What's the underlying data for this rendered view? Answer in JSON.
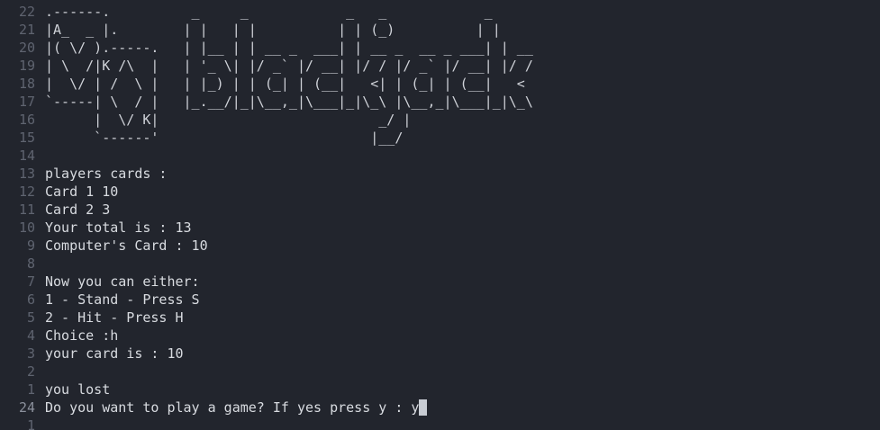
{
  "terminal": {
    "ascii_rows": [
      {
        "number": "22",
        "text": ".------.          _     _            _   _            _"
      },
      {
        "number": "21",
        "text": "|A_  _ |.        | |   | |          | | (_)          | |"
      },
      {
        "number": "20",
        "text": "|( \\/ ).-----.   | |__ | | __ _  ___| | __ _  __ _ ___| | __"
      },
      {
        "number": "19",
        "text": "| \\  /|K /\\  |   | '_ \\| |/ _` |/ __| |/ / |/ _` |/ __| |/ /"
      },
      {
        "number": "18",
        "text": "|  \\/ | /  \\ |   | |_) | | (_| | (__|   <| | (_| | (__|   <"
      },
      {
        "number": "17",
        "text": "`-----| \\  / |   |_.__/|_|\\__,_|\\___|_|\\_\\ |\\__,_|\\___|_|\\_\\"
      },
      {
        "number": "16",
        "text": "      |  \\/ K|                           _/ |"
      },
      {
        "number": "15",
        "text": "      `------'                          |__/"
      }
    ],
    "output_rows": [
      {
        "number": "14",
        "text": ""
      },
      {
        "number": "13",
        "text": "players cards :"
      },
      {
        "number": "12",
        "text": "Card 1 10"
      },
      {
        "number": "11",
        "text": "Card 2 3"
      },
      {
        "number": "10",
        "text": "Your total is : 13"
      },
      {
        "number": "9",
        "text": "Computer's Card : 10"
      },
      {
        "number": "8",
        "text": ""
      },
      {
        "number": "7",
        "text": "Now you can either:"
      },
      {
        "number": "6",
        "text": "1 - Stand - Press S"
      },
      {
        "number": "5",
        "text": "2 - Hit - Press H"
      },
      {
        "number": "4",
        "text": "Choice :h"
      },
      {
        "number": "3",
        "text": "your card is : 10"
      },
      {
        "number": "2",
        "text": ""
      },
      {
        "number": "1",
        "text": "you lost"
      }
    ],
    "current_row": {
      "number": "24",
      "text": "Do you want to play a game? If yes press y : y"
    },
    "after_rows": [
      {
        "number": "1",
        "text": ""
      }
    ],
    "colors": {
      "background": "#22252d",
      "line_number": "#5f6470",
      "text": "#d8dbe0",
      "cursor": "#c8ccd3"
    }
  }
}
